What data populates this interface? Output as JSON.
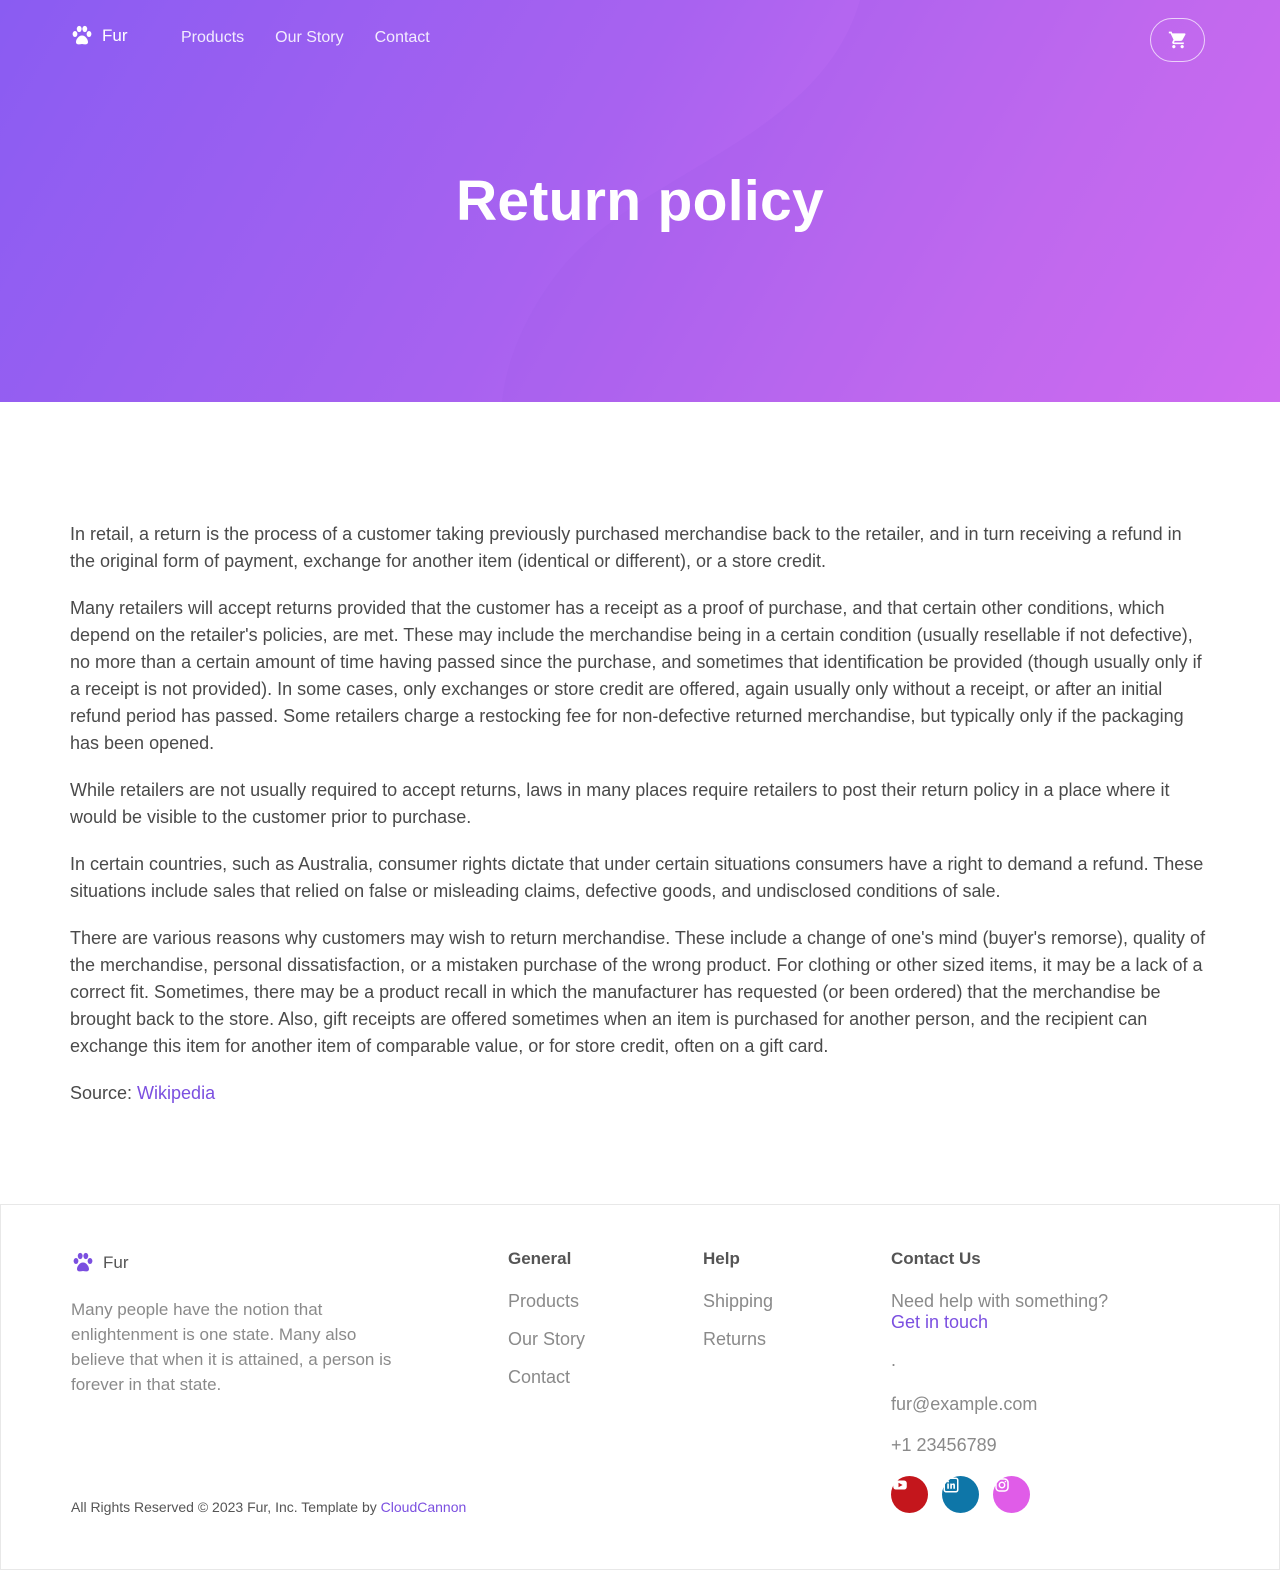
{
  "brand": {
    "name": "Fur",
    "logo_icon": "paw-icon"
  },
  "nav": {
    "links": [
      "Products",
      "Our Story",
      "Contact"
    ],
    "cart_icon": "cart-icon"
  },
  "hero": {
    "title": "Return policy"
  },
  "content": {
    "paragraphs": [
      "In retail, a return is the process of a customer taking previously purchased merchandise back to the retailer, and in turn receiving a refund in the original form of payment, exchange for another item (identical or different), or a store credit.",
      "Many retailers will accept returns provided that the customer has a receipt as a proof of purchase, and that certain other conditions, which depend on the retailer's policies, are met. These may include the merchandise being in a certain condition (usually resellable if not defective), no more than a certain amount of time having passed since the purchase, and sometimes that identification be provided (though usually only if a receipt is not provided). In some cases, only exchanges or store credit are offered, again usually only without a receipt, or after an initial refund period has passed. Some retailers charge a restocking fee for non-defective returned merchandise, but typically only if the packaging has been opened.",
      "While retailers are not usually required to accept returns, laws in many places require retailers to post their return policy in a place where it would be visible to the customer prior to purchase.",
      "In certain countries, such as Australia, consumer rights dictate that under certain situations consumers have a right to demand a refund. These situations include sales that relied on false or misleading claims, defective goods, and undisclosed conditions of sale.",
      "There are various reasons why customers may wish to return merchandise. These include a change of one's mind (buyer's remorse), quality of the merchandise, personal dissatisfaction, or a mistaken purchase of the wrong product. For clothing or other sized items, it may be a lack of a correct fit. Sometimes, there may be a product recall in which the manufacturer has requested (or been ordered) that the merchandise be brought back to the store. Also, gift receipts are offered sometimes when an item is purchased for another person, and the recipient can exchange this item for another item of comparable value, or for store credit, often on a gift card."
    ],
    "source_label": "Source: ",
    "source_link": "Wikipedia"
  },
  "footer": {
    "brand_name": "Fur",
    "description": "Many people have the notion that enlightenment is one state. Many also believe that when it is attained, a person is forever in that state.",
    "general": {
      "heading": "General",
      "links": [
        "Products",
        "Our Story",
        "Contact"
      ]
    },
    "help": {
      "heading": "Help",
      "links": [
        "Shipping",
        "Returns"
      ]
    },
    "contact": {
      "heading": "Contact Us",
      "text": "Need help with something? ",
      "link": "Get in touch",
      "after": ".",
      "email": "fur@example.com",
      "phone": "+1 23456789"
    },
    "socials": [
      {
        "icon": "youtube-icon",
        "color": "#c4161c"
      },
      {
        "icon": "linkedin-icon",
        "color": "#0e76a8"
      },
      {
        "icon": "instagram-icon",
        "color": "#e05ce8"
      }
    ],
    "copyright": "All Rights Reserved © 2023 Fur, Inc. Template by ",
    "copyright_link": "CloudCannon"
  },
  "colors": {
    "accent": "#7b4fe0",
    "hero_gradient_start": "#8a5cf2",
    "hero_gradient_end": "#dd70f2"
  }
}
